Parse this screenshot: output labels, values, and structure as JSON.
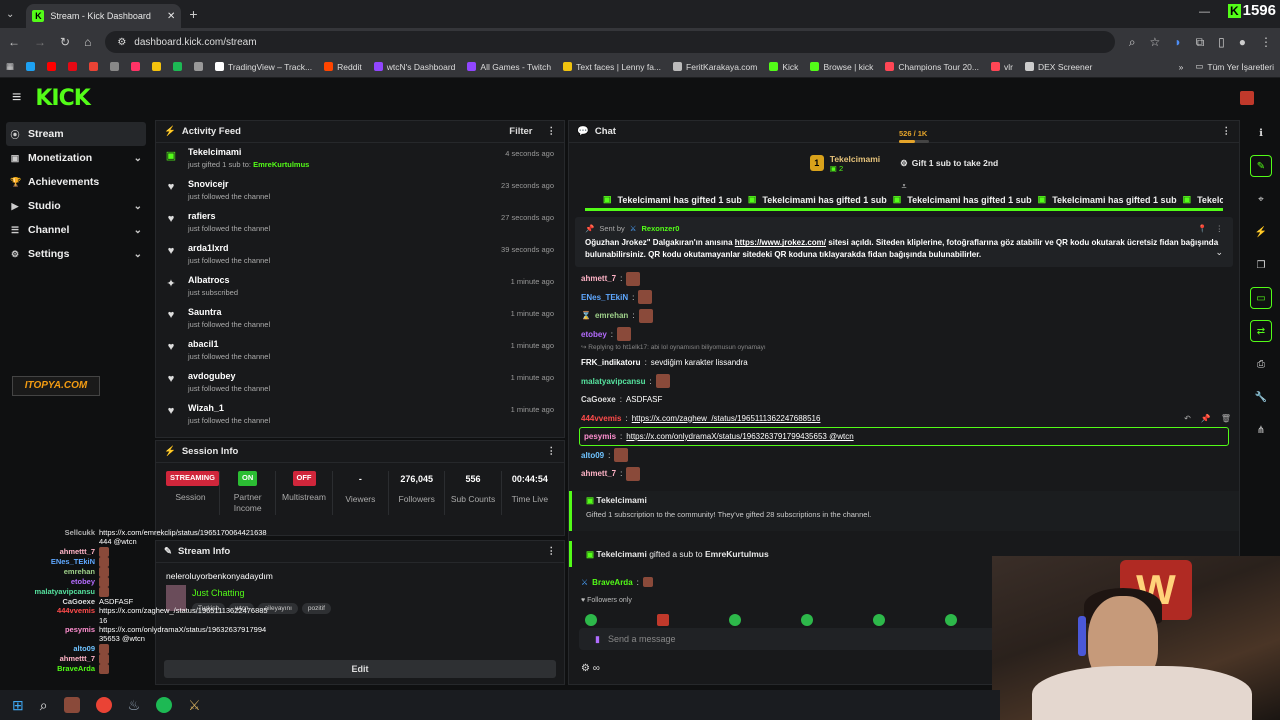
{
  "browser": {
    "tab_title": "Stream - Kick Dashboard",
    "tab_icon": "K",
    "url": "dashboard.kick.com/stream",
    "counter": "1596",
    "bookmarks": [
      {
        "label": "",
        "color": "#1da1f2"
      },
      {
        "label": "",
        "color": "#ff0000"
      },
      {
        "label": "",
        "color": "#e50914"
      },
      {
        "label": "",
        "color": "#ea4335"
      },
      {
        "label": "",
        "color": "#888888"
      },
      {
        "label": "",
        "color": "#ff3366"
      },
      {
        "label": "",
        "color": "#f4c20d"
      },
      {
        "label": "",
        "color": "#1db954"
      },
      {
        "label": "",
        "color": "#999999"
      },
      {
        "label": "TradingView – Track...",
        "color": "#ffffff"
      },
      {
        "label": "Reddit",
        "color": "#ff4500"
      },
      {
        "label": "wtcN's Dashboard",
        "color": "#9146ff"
      },
      {
        "label": "All Games - Twitch",
        "color": "#9146ff"
      },
      {
        "label": "Text faces | Lenny fa...",
        "color": "#f1c40f"
      },
      {
        "label": "FeritKarakaya.com",
        "color": "#bbbbbb"
      },
      {
        "label": "Kick",
        "color": "#53fc18"
      },
      {
        "label": "Browse | kick",
        "color": "#53fc18"
      },
      {
        "label": "Champions Tour 20...",
        "color": "#ff4655"
      },
      {
        "label": "vlr",
        "color": "#ff4655"
      },
      {
        "label": "DEX Screener",
        "color": "#cccccc"
      }
    ],
    "all_bookmarks": "Tüm Yer İşaretleri"
  },
  "sidebar": {
    "items": [
      {
        "label": "Stream",
        "icon": "stream-icon"
      },
      {
        "label": "Monetization",
        "icon": "money-icon"
      },
      {
        "label": "Achievements",
        "icon": "trophy-icon"
      },
      {
        "label": "Studio",
        "icon": "studio-icon"
      },
      {
        "label": "Channel",
        "icon": "channel-icon"
      },
      {
        "label": "Settings",
        "icon": "gear-icon"
      }
    ]
  },
  "activity": {
    "title": "Activity Feed",
    "filter": "Filter",
    "items": [
      {
        "name": "Tekelcimami",
        "sub": "just gifted 1 sub to:",
        "target": "EmreKurtulmus",
        "time": "4 seconds ago",
        "icon": "gift-icon"
      },
      {
        "name": "Snovicejr",
        "sub": "just followed the channel",
        "target": "",
        "time": "23 seconds ago",
        "icon": "heart-icon"
      },
      {
        "name": "rafiers",
        "sub": "just followed the channel",
        "target": "",
        "time": "27 seconds ago",
        "icon": "heart-icon"
      },
      {
        "name": "arda1lxrd",
        "sub": "just followed the channel",
        "target": "",
        "time": "39 seconds ago",
        "icon": "heart-icon"
      },
      {
        "name": "Albatrocs",
        "sub": "just subscribed",
        "target": "",
        "time": "1 minute ago",
        "icon": "star-icon"
      },
      {
        "name": "Sauntra",
        "sub": "just followed the channel",
        "target": "",
        "time": "1 minute ago",
        "icon": "heart-icon"
      },
      {
        "name": "abacil1",
        "sub": "just followed the channel",
        "target": "",
        "time": "1 minute ago",
        "icon": "heart-icon"
      },
      {
        "name": "avdogubey",
        "sub": "just followed the channel",
        "target": "",
        "time": "1 minute ago",
        "icon": "heart-icon"
      },
      {
        "name": "Wizah_1",
        "sub": "just followed the channel",
        "target": "",
        "time": "1 minute ago",
        "icon": "heart-icon"
      }
    ]
  },
  "session": {
    "title": "Session Info",
    "cells": [
      {
        "pill": "STREAMING",
        "pill_color": "red",
        "value": "",
        "label": "Session"
      },
      {
        "pill": "ON",
        "pill_color": "green",
        "value": "",
        "label": "Partner Income"
      },
      {
        "pill": "OFF",
        "pill_color": "red",
        "value": "",
        "label": "Multistream"
      },
      {
        "pill": "",
        "pill_color": "",
        "value": "-",
        "label": "Viewers"
      },
      {
        "pill": "",
        "pill_color": "",
        "value": "276,045",
        "label": "Followers"
      },
      {
        "pill": "",
        "pill_color": "",
        "value": "556",
        "label": "Sub Counts"
      },
      {
        "pill": "",
        "pill_color": "",
        "value": "00:44:54",
        "label": "Time Live"
      }
    ]
  },
  "stream_info": {
    "title": "Stream Info",
    "stream_title": "neleroluyorbenkonyadaydım",
    "category": "Just Chatting",
    "tags": [
      "Turkish",
      "wtcn",
      "aileyayını",
      "pozitif"
    ],
    "edit": "Edit"
  },
  "overlay_chat": [
    {
      "user": "Sellcukk",
      "color": "#b0b0b0",
      "msg": "https://x.com/emrekclip/status/1965170064421638444 @wtcn"
    },
    {
      "user": "ahmettt_7",
      "color": "#ffb3c6",
      "msg": ""
    },
    {
      "user": "ENes_TEkiN",
      "color": "#5fa8ff",
      "msg": ""
    },
    {
      "user": "emrehan",
      "color": "#9fd18a",
      "msg": ""
    },
    {
      "user": "etobey",
      "color": "#b56cff",
      "msg": ""
    },
    {
      "user": "malatyavipcansu",
      "color": "#56e39f",
      "msg": ""
    },
    {
      "user": "CaGoexe",
      "color": "#dddddd",
      "msg": "ASDFASF"
    },
    {
      "user": "444vvemis",
      "color": "#ff4b4b",
      "msg": "https://x.com/zaghew_/status/1965111362247688516"
    },
    {
      "user": "pesymis",
      "color": "#ff8fd0",
      "msg": "https://x.com/onlydramaX/status/1963263791799435653 @wtcn"
    },
    {
      "user": "alto09",
      "color": "#6fc3ff",
      "msg": ""
    },
    {
      "user": "ahmettt_7",
      "color": "#ffb3c6",
      "msg": ""
    },
    {
      "user": "BraveArda",
      "color": "#53fc18",
      "msg": ""
    }
  ],
  "chat": {
    "title": "Chat",
    "top_gifter": "Tekelcimami",
    "top_gifter_count": "2",
    "top_rank": "1",
    "gift_prompt": "Gift 1 sub to take 2nd",
    "gifts_banner": "Tekelcimami has gifted 1 sub",
    "pinned_by": "Sent by",
    "pinned_user": "Rexonzer0",
    "pinned_text": "Oğuzhan Jrokez\" Dalgakıran'ın anısına",
    "pinned_link": "https://www.jrokez.com/",
    "pinned_rest": "sitesi açıldı. Siteden kliplerine, fotoğraflarına göz atabilir ve QR kodu okutarak ücretsiz fidan bağışında bulunabilirsiniz. QR kodu okutamayanlar sitedeki QR koduna tıklayarakda fidan bağışında bulunabilirler.",
    "reply_text": "Replying to ht1elk17: abi lol oynamısın biliyomusun oynamayı",
    "messages": [
      {
        "user": "ahmett_7",
        "color": "#ffb3c6",
        "text": "",
        "emote": true
      },
      {
        "user": "ENes_TEkiN",
        "color": "#5fa8ff",
        "text": "",
        "emote": true
      },
      {
        "user": "emrehan",
        "color": "#9fd18a",
        "text": "",
        "emote": true
      },
      {
        "user": "etobey",
        "color": "#b56cff",
        "text": "",
        "emote": true
      },
      {
        "user": "FRK_indikatoru",
        "color": "#ffffff",
        "text": "sevdiğim karakter lissandra",
        "emote": false
      },
      {
        "user": "malatyavipcansu",
        "color": "#56e39f",
        "text": "",
        "emote": true
      },
      {
        "user": "CaGoexe",
        "color": "#dddddd",
        "text": "ASDFASF",
        "emote": false
      },
      {
        "user": "444vvemis",
        "color": "#ff4b4b",
        "text": "https://x.com/zaghew_/status/1965111362247688516",
        "emote": false
      },
      {
        "user": "pesymis",
        "color": "#ff8fd0",
        "text": "https://x.com/onlydramaX/status/1963263791799435653 @wtcn",
        "emote": false
      },
      {
        "user": "alto09",
        "color": "#6fc3ff",
        "text": "",
        "emote": true
      },
      {
        "user": "ahmett_7",
        "color": "#ffb3c6",
        "text": "",
        "emote": true
      }
    ],
    "sub_user": "Tekelcimami",
    "sub_desc": "Gifted 1 subscription to the community! They've gifted 28 subscriptions in the channel.",
    "sub_progress": "526 / 1K",
    "sub_progress_fraction": 0.526,
    "gift_line_user": "Tekelcimami",
    "gift_line_text": "gifted a sub to",
    "gift_line_target": "EmreKurtulmus",
    "brave_user": "BraveArda",
    "followers_only": "Followers only",
    "placeholder": "Send a message",
    "footer_icon": "∞"
  },
  "colors": {
    "accent": "#53fc18",
    "bg": "#0f1011",
    "panel": "#18191b"
  }
}
